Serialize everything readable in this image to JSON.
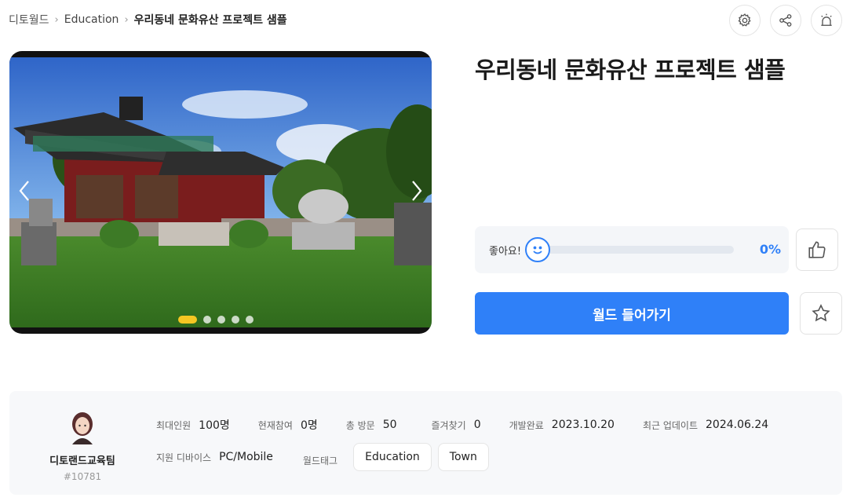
{
  "breadcrumb": {
    "home": "디토월드",
    "category": "Education",
    "current": "우리동네 문화유산 프로젝트 샘플"
  },
  "icons": {
    "settings": "gear-icon",
    "share": "share-icon",
    "report": "siren-icon",
    "like": "thumbs-up-icon",
    "favorite": "star-icon",
    "smile": "smile-icon"
  },
  "world": {
    "title": "우리동네 문화유산 프로젝트 샘플"
  },
  "carousel": {
    "slide_count": 5,
    "active_index": 0
  },
  "like": {
    "label": "좋아요!",
    "percent_text": "0%",
    "percent": 0
  },
  "actions": {
    "enter_label": "월드 들어가기"
  },
  "creator": {
    "name": "디토랜드교육팀",
    "id": "#10781"
  },
  "stats": [
    {
      "label": "최대인원",
      "value": "100명"
    },
    {
      "label": "현재참여",
      "value": "0명"
    },
    {
      "label": "총 방문",
      "value": "50"
    },
    {
      "label": "즐겨찾기",
      "value": "0"
    },
    {
      "label": "개발완료",
      "value": "2023.10.20"
    },
    {
      "label": "최근 업데이트",
      "value": "2024.06.24"
    }
  ],
  "device": {
    "label": "지원 디바이스",
    "value": "PC/Mobile"
  },
  "tags": {
    "label": "월드태그",
    "items": [
      "Education",
      "Town"
    ]
  },
  "colors": {
    "accent": "#2f80f8",
    "dot_active": "#f5c623"
  }
}
